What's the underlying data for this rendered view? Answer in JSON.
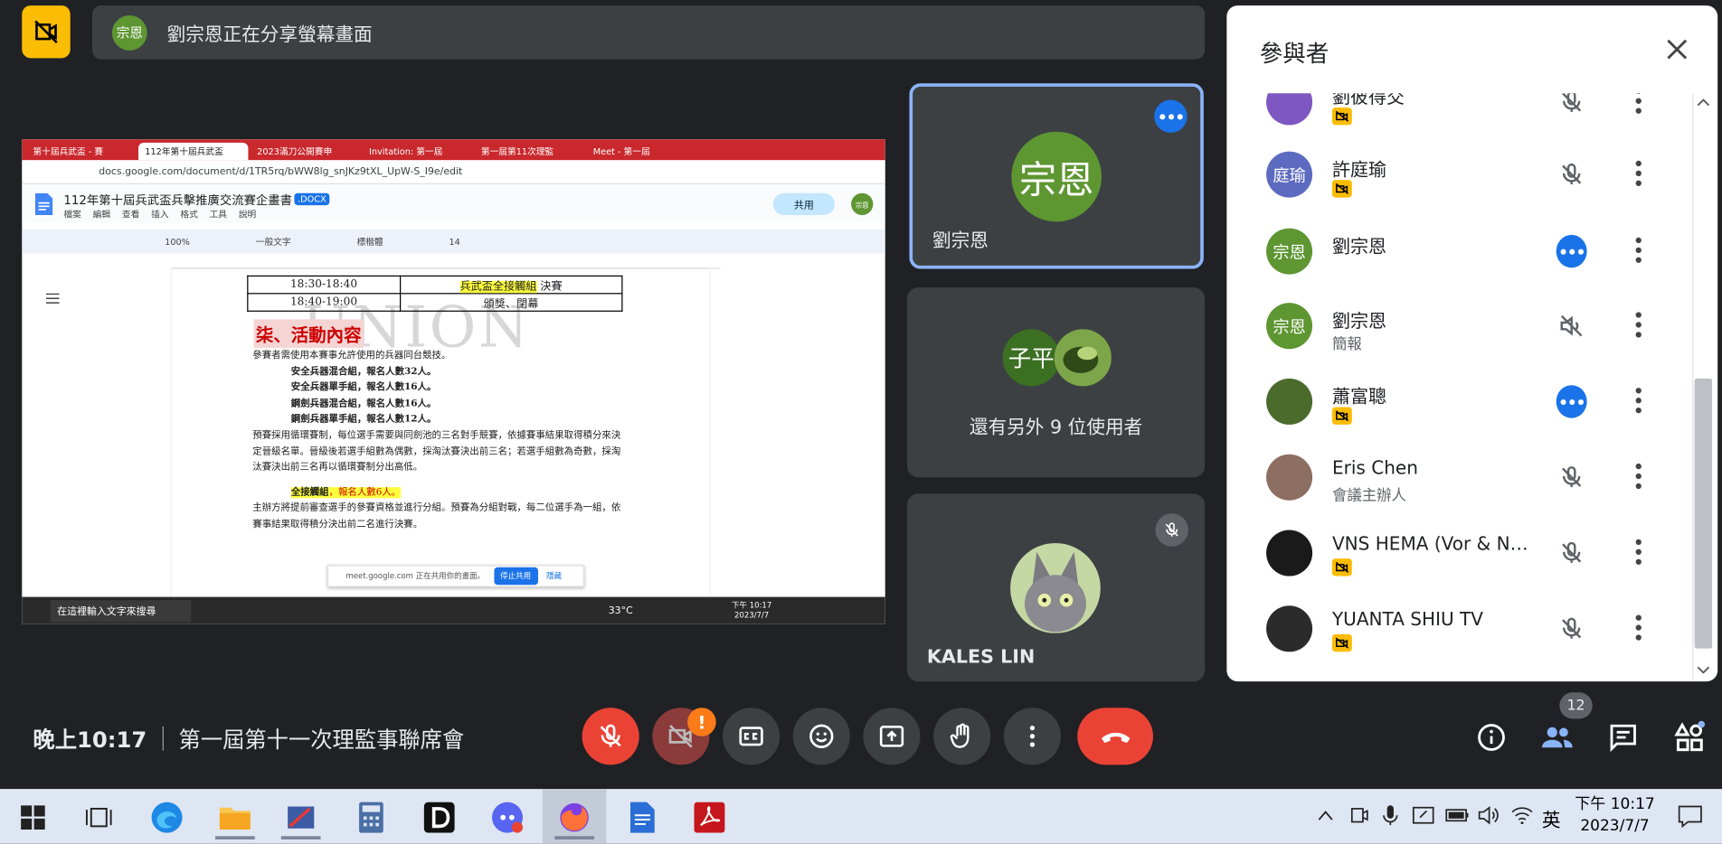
{
  "presenting": {
    "avatar_text": "宗恩",
    "message": "劉宗恩正在分享螢幕畫面"
  },
  "shared_screen": {
    "tabs": [
      "第十屆兵武盃 - 賽",
      "112年第十屆兵武盃",
      "2023滿刀公開賽申",
      "Invitation: 第一屆",
      "第一屆第11次理監",
      "Meet - 第一屆"
    ],
    "url": "docs.google.com/document/d/1TR5rq/bWW8lg_snJKz9tXL_UpW-S_I9e/edit",
    "doc_title": "112年第十屆兵武盃兵擊推廣交流賽企畫書",
    "doc_format": ".DOCX",
    "doc_menus": "檔案 編輯 查看 插入 格式 工具 說明",
    "share_label": "共用",
    "toolbar_zoom": "100%",
    "toolbar_style": "一般文字",
    "toolbar_font": "標楷體",
    "toolbar_size": "14",
    "schedule": [
      {
        "time": "18:30-18:40",
        "event_hl": "兵武盃全接觸組",
        "event": " 決賽"
      },
      {
        "time": "18:40-19:00",
        "event_hl": "",
        "event": "頒獎、閉幕"
      }
    ],
    "watermark": "UNION",
    "section_title": "柒、活動內容",
    "intro": "參賽者需使用本賽事允許使用的兵器同台競技。",
    "categories": [
      "安全兵器混合組，報名人數32人。",
      "安全兵器單手組，報名人數16人。",
      "鋼劍兵器混合組，報名人數16人。",
      "鋼劍兵器單手組，報名人數12人。"
    ],
    "para1": "預賽採用循環賽制，每位選手需要與同劍池的三名對手競賽，依據賽事結果取得積分來決定晉級名單。晉級後若選手組數為偶數，採淘汰賽決出前三名；若選手組數為奇數，採淘汰賽決出前三名再以循環賽制分出高低。",
    "full_contact_label": "全接觸組",
    "full_contact_count": "，報名人數6人。",
    "para2": "主辦方將提前審查選手的參賽資格並進行分組。預賽為分組對戰，每二位選手為一組，依賽事結果取得積分決出前二名進行決賽。",
    "sharing_text": "meet.google.com 正在共用你的畫面。",
    "stop_sharing": "停止共用",
    "hide": "隱藏",
    "win_search": "在這裡輸入文字來搜尋",
    "weather": "33°C",
    "clock_time": "下午 10:17",
    "clock_date": "2023/7/7"
  },
  "tiles": [
    {
      "avatar_text": "宗恩",
      "name": "劉宗恩",
      "avatar_color": "#5e9632"
    },
    {
      "avatar_text": "子平",
      "others_text": "還有另外 9 位使用者",
      "avatar_color": "#3b6f22"
    },
    {
      "name": "KALES LIN"
    }
  ],
  "panel": {
    "title": "參與者",
    "participants": [
      {
        "name": "劉彼得交",
        "sub": "",
        "avatar": "",
        "avatar_color": "#7e57c2",
        "cam_off": true,
        "mic": "muted"
      },
      {
        "name": "許庭瑜",
        "sub": "",
        "avatar": "庭瑜",
        "avatar_color": "#5c6bc0",
        "cam_off": true,
        "mic": "muted"
      },
      {
        "name": "劉宗恩",
        "sub": "",
        "avatar": "宗恩",
        "avatar_color": "#5e9632",
        "cam_off": false,
        "mic": "speaking"
      },
      {
        "name": "劉宗恩",
        "sub": "簡報",
        "avatar": "宗恩",
        "avatar_color": "#5e9632",
        "cam_off": false,
        "mic": "volume-off"
      },
      {
        "name": "蕭富聰",
        "sub": "",
        "avatar": "",
        "avatar_color": "#4a6b2c",
        "cam_off": true,
        "mic": "speaking"
      },
      {
        "name": "Eris Chen",
        "sub": "會議主辦人",
        "avatar": "",
        "avatar_color": "#8d6e63",
        "cam_off": false,
        "mic": "muted"
      },
      {
        "name": "VNS HEMA (Vor & Nac...",
        "sub": "",
        "avatar": "",
        "avatar_color": "#1a1a1a",
        "cam_off": true,
        "mic": "muted"
      },
      {
        "name": "YUANTA SHIU TV",
        "sub": "",
        "avatar": "",
        "avatar_color": "#2b2b2b",
        "cam_off": true,
        "mic": "muted"
      }
    ]
  },
  "controls": {
    "time": "晚上10:17",
    "meeting_name": "第一屆第十一次理監事聯席會",
    "warning": "!",
    "people_count": "12"
  },
  "taskbar": {
    "ime": "英",
    "time": "下午 10:17",
    "date": "2023/7/7"
  },
  "colors": {
    "accent": "#1a73e8",
    "danger": "#ea4335",
    "camera_off_chip": "#fbbc04",
    "active_border": "#8ab4f8"
  }
}
